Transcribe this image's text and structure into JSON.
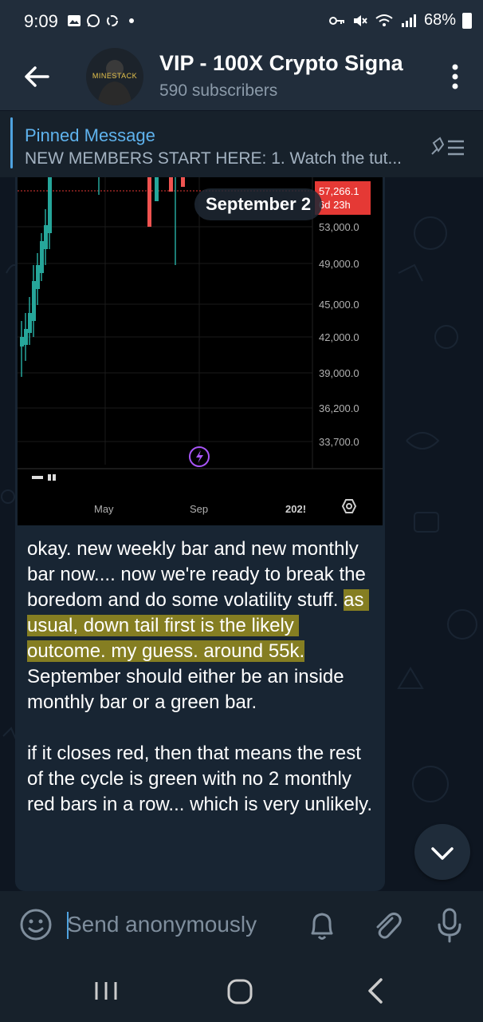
{
  "status_bar": {
    "time": "9:09",
    "battery": "68%"
  },
  "header": {
    "title": "VIP - 100X Crypto Signa",
    "subscribers": "590 subscribers",
    "avatar_text": "MINESTACK"
  },
  "pinned": {
    "title": "Pinned Message",
    "text": "NEW MEMBERS START HERE: 1. Watch the tut..."
  },
  "message": {
    "date_pill": "September 2",
    "text_before": "okay. new weekly bar and new monthly bar now.... now we're ready to break the boredom and do some volatility stuff. ",
    "text_highlight": "as usual, down tail first is the likely outcome. my guess. around 55k.",
    "text_after": " September should either be an inside monthly bar or a green bar.\n\nif it closes red, then that means the rest of the cycle is green with no 2 monthly red bars in a row... which is very unlikely."
  },
  "chart_image": {
    "price_tag": "57,266.1",
    "price_countdown": "6d 23h",
    "price_levels": [
      "53,000.0",
      "49,000.0",
      "45,000.0",
      "42,000.0",
      "39,000.0",
      "36,200.0",
      "33,700.0"
    ],
    "x_labels": [
      "May",
      "Sep",
      "202!"
    ]
  },
  "input": {
    "placeholder": "Send anonymously"
  },
  "colors": {
    "accent": "#5fb3ee",
    "bubble": "#182533",
    "highlight": "#e0c814",
    "price_tag": "#e53935"
  }
}
